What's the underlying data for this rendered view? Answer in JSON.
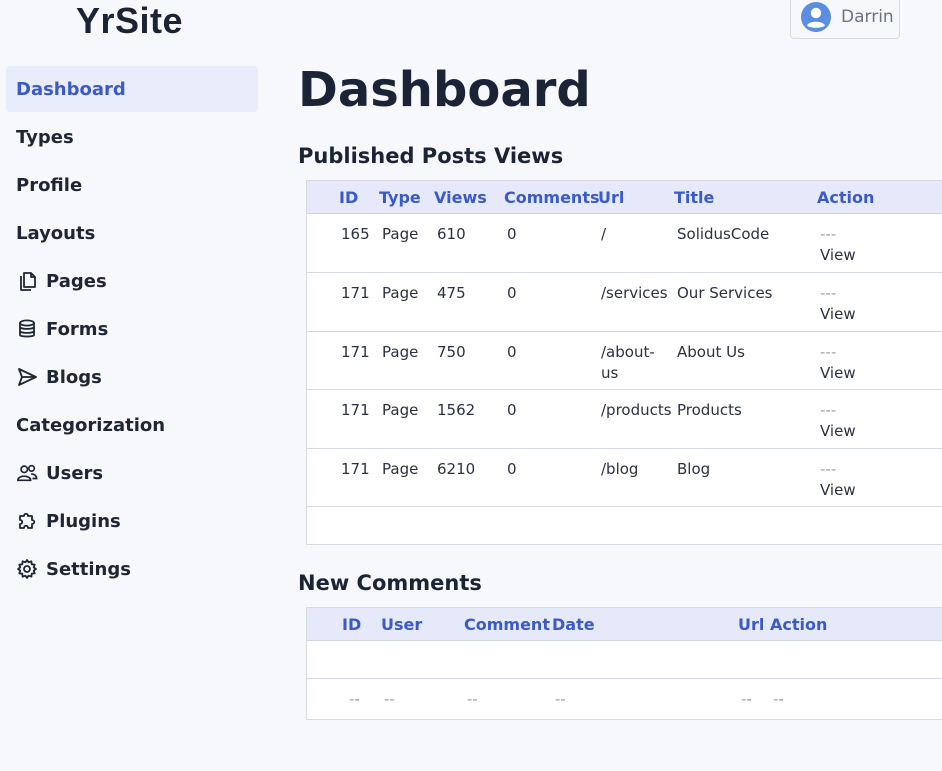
{
  "brand": {
    "logo_text": "YrSite"
  },
  "user": {
    "name": "Darrin",
    "icon": "user-circle-icon"
  },
  "sidebar": {
    "items": [
      {
        "label": "Dashboard",
        "icon": null,
        "active": true
      },
      {
        "label": "Types",
        "icon": null
      },
      {
        "label": "Profile",
        "icon": null
      },
      {
        "label": "Layouts",
        "icon": null
      },
      {
        "label": "Pages",
        "icon": "pages-icon"
      },
      {
        "label": "Forms",
        "icon": "database-icon"
      },
      {
        "label": "Blogs",
        "icon": "send-icon"
      },
      {
        "label": "Categorization",
        "icon": null
      },
      {
        "label": "Users",
        "icon": "users-icon"
      },
      {
        "label": "Plugins",
        "icon": "puzzle-icon"
      },
      {
        "label": "Settings",
        "icon": "gear-icon"
      }
    ]
  },
  "main": {
    "title": "Dashboard",
    "posts": {
      "title": "Published Posts Views",
      "headers": [
        "ID",
        "Type",
        "Views",
        "Comments",
        "Url",
        "Title",
        "Action"
      ],
      "rows": [
        {
          "id": "165",
          "type": "Page",
          "views": "610",
          "comments": "0",
          "url": "/",
          "title": "SolidusCode",
          "action_dash": "---",
          "action_link": "View"
        },
        {
          "id": "171",
          "type": "Page",
          "views": "475",
          "comments": "0",
          "url": "/services",
          "title": "Our Services",
          "action_dash": "---",
          "action_link": "View"
        },
        {
          "id": "171",
          "type": "Page",
          "views": "750",
          "comments": "0",
          "url": "/about-us",
          "title": "About Us",
          "action_dash": "---",
          "action_link": "View"
        },
        {
          "id": "171",
          "type": "Page",
          "views": "1562",
          "comments": "0",
          "url": "/products",
          "title": "Products",
          "action_dash": "---",
          "action_link": "View"
        },
        {
          "id": "171",
          "type": "Page",
          "views": "6210",
          "comments": "0",
          "url": "/blog",
          "title": "Blog",
          "action_dash": "---",
          "action_link": "View"
        }
      ]
    },
    "comments": {
      "title": "New Comments",
      "headers": [
        "ID",
        "User",
        "Comment",
        "Date",
        "Url",
        "Action"
      ],
      "placeholder_row": [
        "--",
        "--",
        "--",
        "--",
        "--",
        "--"
      ]
    }
  },
  "colors": {
    "accent": "#3b5ac7",
    "header_bg": "#e5e9fa",
    "active_bg": "#e9edfb",
    "text": "#1e2533"
  }
}
